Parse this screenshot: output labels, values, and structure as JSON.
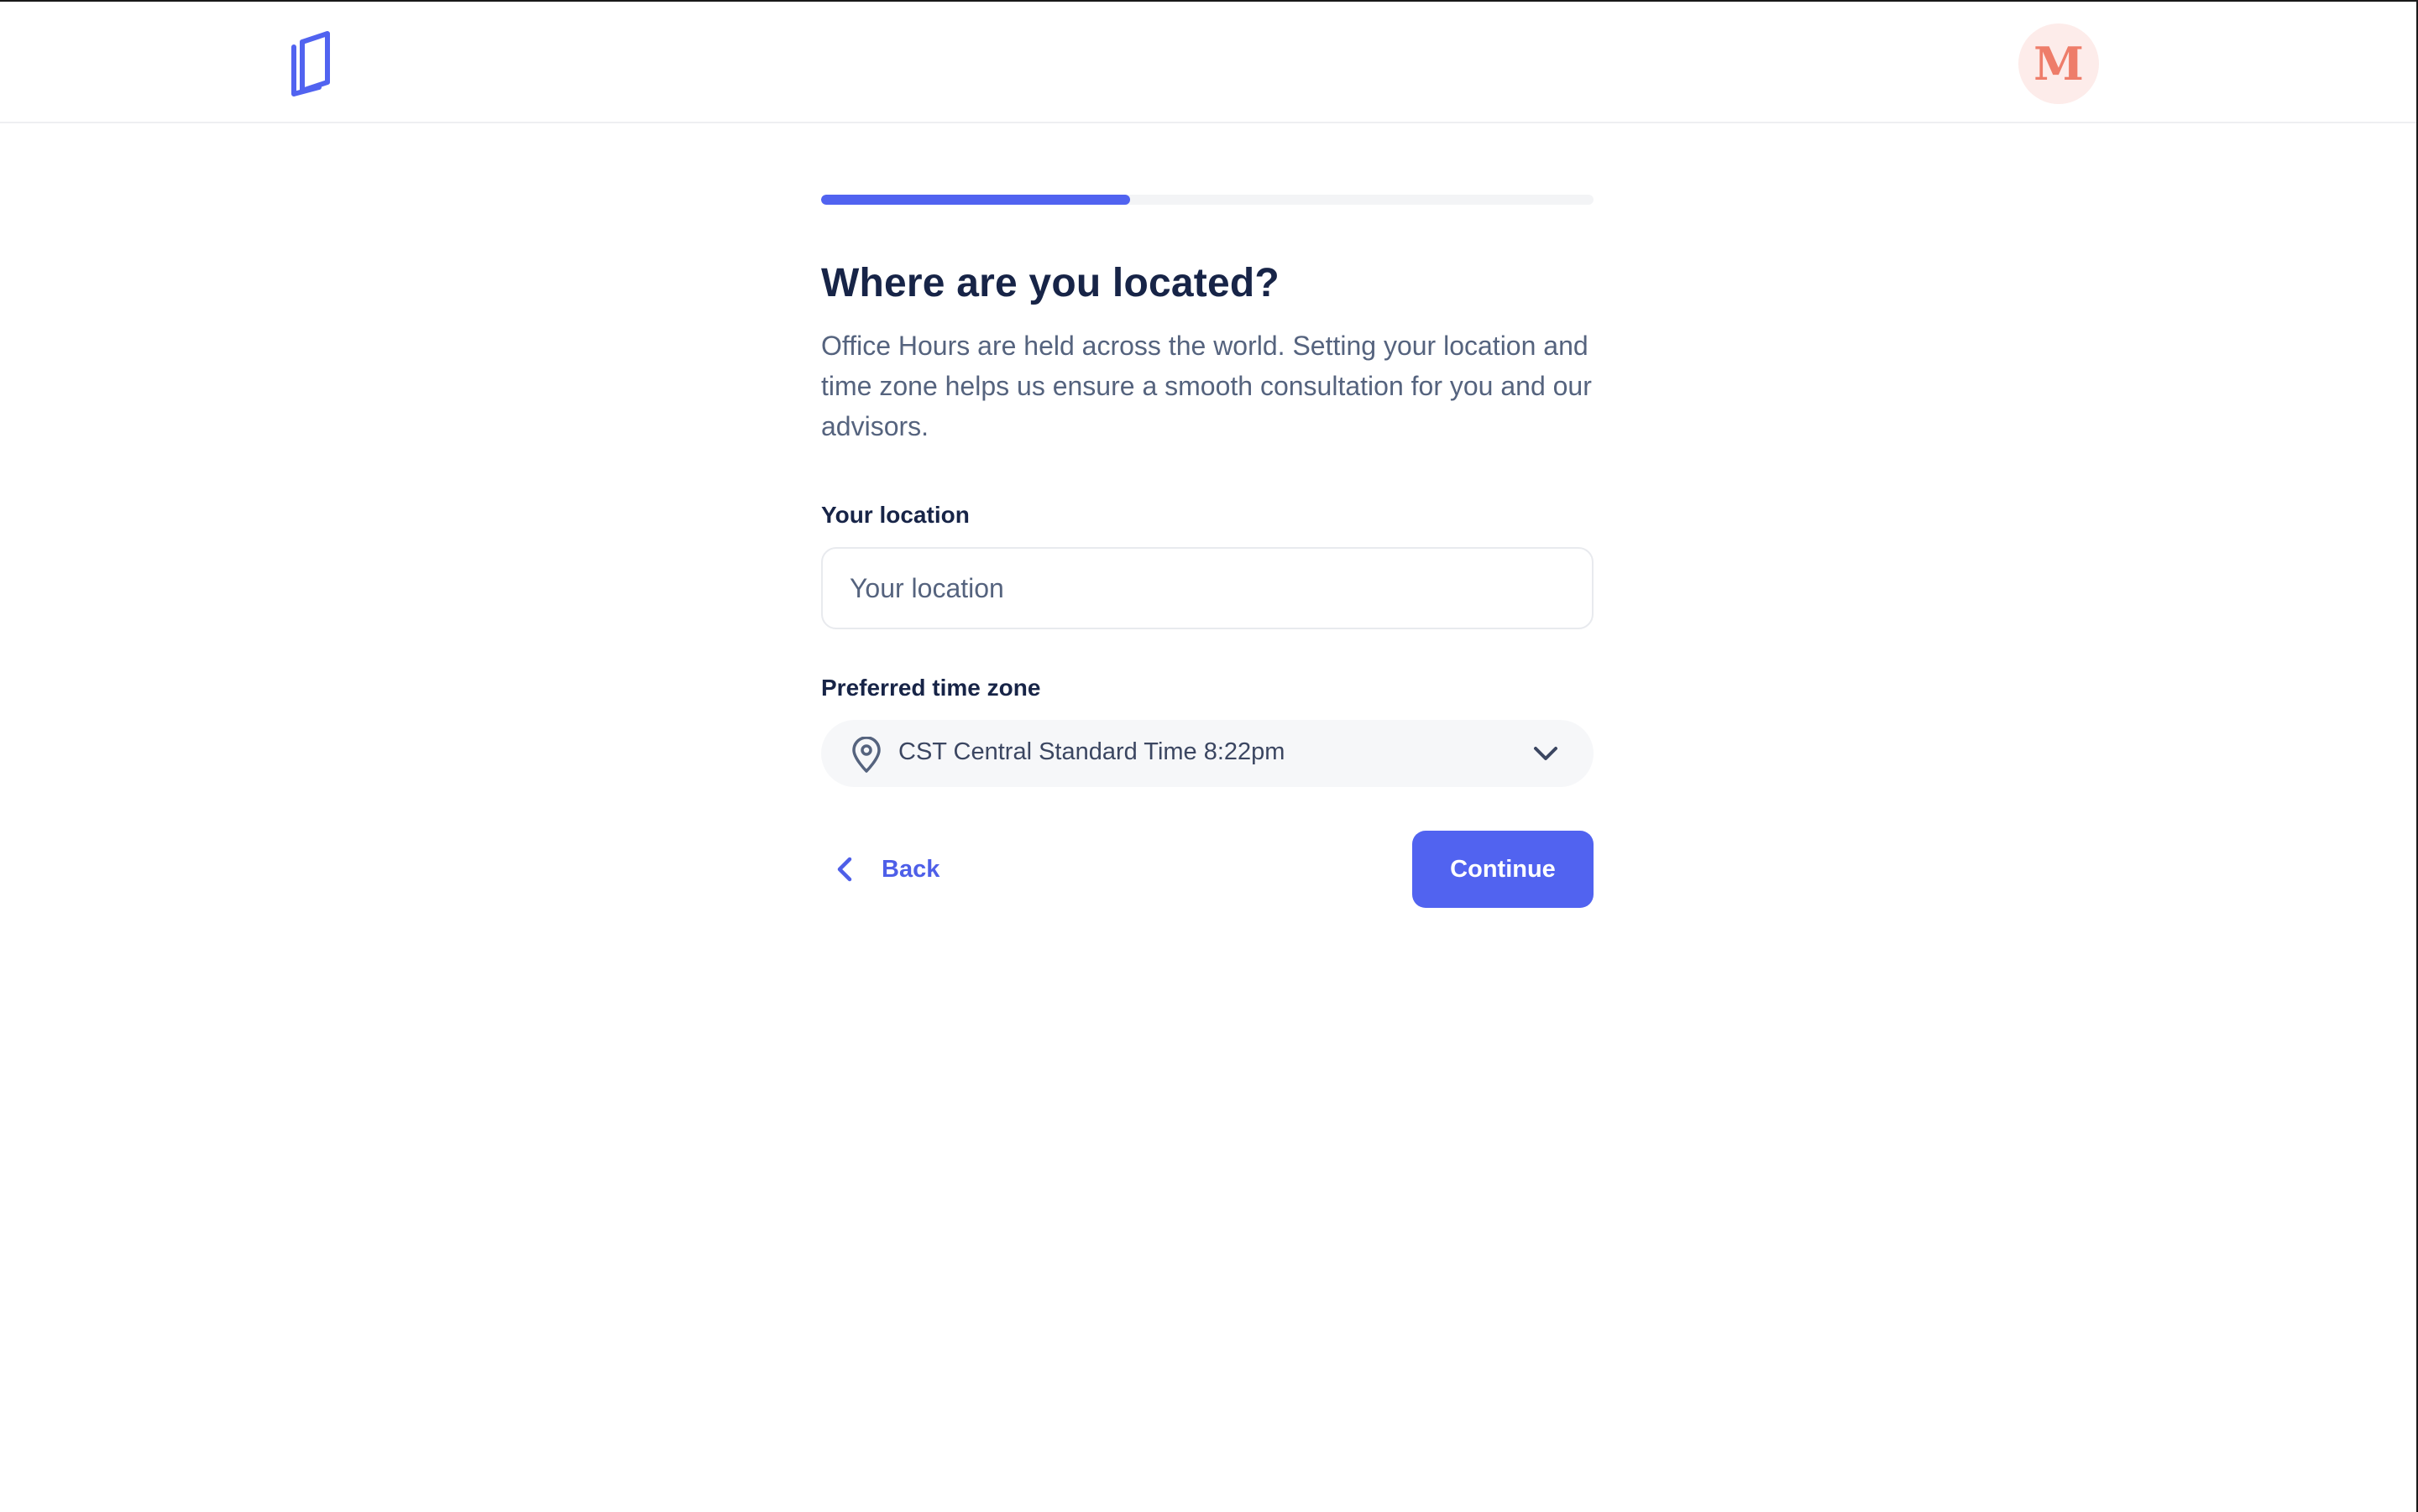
{
  "header": {
    "logo_icon": "book-logo-icon",
    "avatar_initial": "M",
    "avatar_color": "#ee7d6a"
  },
  "progress": {
    "fraction": 0.4,
    "color": "#5163f0"
  },
  "main": {
    "title": "Where are you located?",
    "subtitle": "Office Hours are held across the world. Setting your location and time zone helps us ensure a smooth consultation for you and our advisors."
  },
  "location": {
    "label": "Your location",
    "placeholder": "Your location",
    "value": ""
  },
  "timezone": {
    "label": "Preferred time zone",
    "selected": "CST Central Standard Time 8:22pm",
    "icon": "map-pin-icon"
  },
  "actions": {
    "back_label": "Back",
    "continue_label": "Continue"
  }
}
